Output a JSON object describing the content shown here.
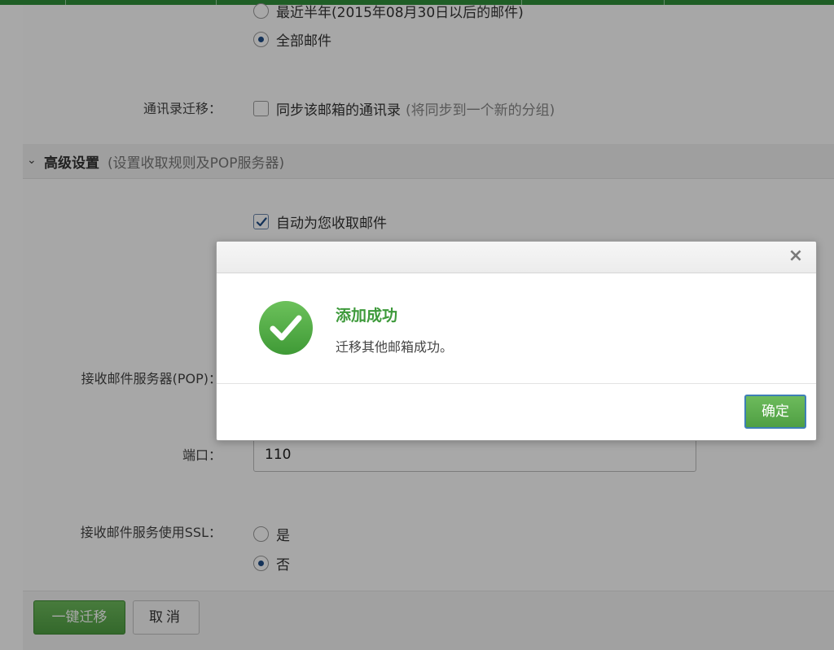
{
  "form": {
    "range_recent_half_year": "最近半年(2015年08月30日以后的邮件)",
    "range_all": "全部邮件",
    "contacts_label": "通讯录迁移：",
    "contacts_option": "同步该邮箱的通讯录",
    "contacts_hint": "(将同步到一个新的分组)",
    "advanced_title": "高级设置",
    "advanced_note": "(设置收取规则及POP服务器)",
    "auto_receive": "自动为您收取邮件",
    "pop_server_label": "接收邮件服务器(POP)：",
    "port_label": "端口：",
    "port_value": "110",
    "ssl_label": "接收邮件服务使用SSL：",
    "ssl_yes": "是",
    "ssl_no": "否"
  },
  "footer": {
    "migrate_button": "一键迁移",
    "cancel_button": "取消"
  },
  "dialog": {
    "close_glyph": "×",
    "title": "添加成功",
    "message": "迁移其他邮箱成功。",
    "confirm_button": "确定"
  },
  "colors": {
    "success_green": "#4f9f43",
    "title_green": "#3e9a3b",
    "overlay": "rgba(0,0,0,0.34)"
  }
}
